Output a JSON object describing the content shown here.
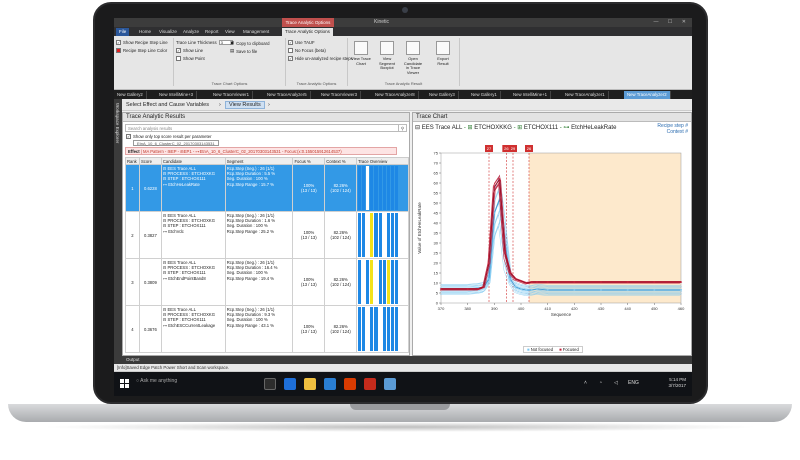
{
  "window": {
    "title": "Kinetic",
    "context_tab": "Trace Analytic Options",
    "controls": "— ☐ ✕"
  },
  "ribbon_tabs": [
    "File",
    "Home",
    "Visualize",
    "Analyze",
    "Report",
    "View",
    "Management",
    "Trace Analytic Options"
  ],
  "ribbon": {
    "show_step_line": "Show Recipe Step Line",
    "step_line_color": "Recipe Step Line Color",
    "step_line_color_hex": "#e02020",
    "show_line": "Show Line",
    "show_point": "Show Point",
    "line_thickness_label": "Trace Line Thickness",
    "line_thickness_value": "3",
    "copy_clipboard": "Copy to clipboard",
    "save_file": "Save to file",
    "group_chart_options": "Trace Chart Options",
    "use_tmuf": "Use TAUF",
    "no_focus": "No Focus (beta)",
    "hide_analyzed": "Hide un-analyzed recipe steps",
    "btn_view_trace": "View Trace Chart",
    "btn_view_segment": "View Segment Boxplot",
    "btn_open_candidate": "Open Candidate in Trace Viewer",
    "btn_export": "Export Result",
    "group_analytic_options": "Trace Analytic Options",
    "group_analytic_result": "Trace Analytic Result"
  },
  "doc_tabs": [
    "New Gallery2",
    "New IntelliMine+3",
    "New TraceViewer1",
    "New TraceAnalyzer5",
    "New TraceViewer3",
    "New TraceAnalyzer8",
    "New Gallery3",
    "New Gallery1",
    "New IntelliMine+1",
    "New TraceAnalyzer1",
    "New TraceAnalyzer2"
  ],
  "explorer_label": "Workspace Explorer",
  "breadcrumbs": {
    "step1": "Select Effect and Cause Variables",
    "step2": "View Results"
  },
  "results_panel": {
    "title": "Trace Analytic Results",
    "search_placeholder": "Search analysis results",
    "show_top_only": "Show only top score result per parameter",
    "chip": "EtnA_10_6_ClusterC_02_20170303143531",
    "effect_label": "Effect",
    "effect_text": " | MA Pattern - ⊞EP - ⊞EP1 - ⊶EtnA_10_6_ClusterC_02_20170303143531 - Focus:(x:0.155015912614537)",
    "columns": [
      "Rank",
      "Score",
      "Candidate",
      "Segment",
      "Focus %",
      "Context %",
      "Trace Overview"
    ],
    "rows": [
      {
        "rank": "1",
        "score": "0.6228",
        "tree": [
          "⊟ EES Trace ALL",
          "  ⊟ PROCESS : ETCHOXKG",
          "    ⊟ STEP : ETCHOX111",
          "      ⊶ EtchHeLeakRate"
        ],
        "segment": [
          "Rcp.Step (Seg.) : 26 (1/1)",
          "Rcp.Step Duration : 5.5 %",
          "Seg. Duration : 100 %",
          "Rcp.Step Range : 15.7 %"
        ],
        "focus": "100%\n(13 / 13)",
        "context": "82.26%\n(102 / 124)"
      },
      {
        "rank": "2",
        "score": "0.3827",
        "tree": [
          "⊟ EES Trace ALL",
          "  ⊟ PROCESS : ETCHOXKG",
          "    ⊟ STEP : ETCHOX111",
          "      ⊶ EtchVdc"
        ],
        "segment": [
          "Rcp.Step (Seg.) : 26 (1/1)",
          "Rcp.Step Duration : 1.6 %",
          "Seg. Duration : 100 %",
          "Rcp.Step Range : 25.2 %"
        ],
        "focus": "100%\n(13 / 13)",
        "context": "82.26%\n(102 / 124)"
      },
      {
        "rank": "3",
        "score": "0.3809",
        "tree": [
          "⊟ EES Trace ALL",
          "  ⊟ PROCESS : ETCHOXKG",
          "    ⊟ STEP : ETCHOX111",
          "      ⊶ EtchEndPointBand8"
        ],
        "segment": [
          "Rcp.Step (Seg.) : 26 (1/1)",
          "Rcp.Step Duration : 16.4 %",
          "Seg. Duration : 100 %",
          "Rcp.Step Range : 19.4 %"
        ],
        "focus": "100%\n(13 / 13)",
        "context": "82.26%\n(102 / 124)"
      },
      {
        "rank": "4",
        "score": "0.3676",
        "tree": [
          "⊟ EES Trace ALL",
          "  ⊟ PROCESS : ETCHOXKG",
          "    ⊟ STEP : ETCHOX111",
          "      ⊶ EtchESCCurrentLeakage"
        ],
        "segment": [
          "Rcp.Step (Seg.) : 26 (1/1)",
          "Rcp.Step Duration : 9.3 %",
          "Seg. Duration : 100 %",
          "Rcp.Step Range : 43.1 %"
        ],
        "focus": "100%\n(13 / 13)",
        "context": "82.26%\n(102 / 124)"
      }
    ]
  },
  "chart_panel": {
    "title": "Trace Chart",
    "header_trace": "EES Trace ALL",
    "header_process": "ETCHOXKKG",
    "header_step": "ETCHOX111",
    "header_param": "EtchHeLeakRate",
    "recipe_step": "Recipe step #",
    "context_label": "Context #",
    "legend_not_focused": "Not focused",
    "legend_focused": "Focused"
  },
  "chart_data": {
    "type": "line",
    "xlabel": "Sequence",
    "ylabel": "Value of EtchHeLeakRate",
    "xlim": [
      370,
      460
    ],
    "ylim": [
      0,
      75
    ],
    "xticks": [
      370,
      380,
      390,
      400,
      410,
      420,
      430,
      440,
      450,
      460
    ],
    "yticks": [
      0,
      5,
      10,
      15,
      20,
      25,
      30,
      35,
      40,
      45,
      50,
      55,
      60,
      65,
      70,
      75
    ],
    "step_markers": [
      {
        "label": "27",
        "x": 388
      },
      {
        "label": "26",
        "x": 394.5
      },
      {
        "label": "29",
        "x": 397
      },
      {
        "label": "26",
        "x": 403
      }
    ],
    "highlight_region": [
      403,
      460
    ],
    "series": [
      {
        "name": "Not focused",
        "color": "#7ec8f0",
        "x": [
          370,
          380,
          384,
          386,
          388,
          390,
          392,
          394,
          396,
          398,
          400,
          402,
          404,
          406,
          410,
          420,
          430,
          440,
          450,
          460
        ],
        "y": [
          7,
          7,
          7.5,
          8,
          12,
          45,
          52,
          30,
          12,
          8,
          7,
          6.5,
          6.5,
          7,
          6.5,
          6.5,
          6.5,
          6.5,
          6.5,
          6.5
        ]
      },
      {
        "name": "Focused",
        "color": "#c0203a",
        "x": [
          370,
          380,
          384,
          386,
          388,
          390,
          392,
          394,
          396,
          398,
          400,
          402,
          404,
          406,
          410,
          420,
          430,
          440,
          450,
          460
        ],
        "y": [
          7,
          7,
          7,
          8,
          20,
          58,
          62,
          25,
          15,
          12,
          11,
          10,
          10.5,
          10.5,
          10.5,
          10.5,
          10.5,
          10.5,
          10.5,
          10.5
        ]
      }
    ]
  },
  "output_label": "Output",
  "status_text": "[Info]Saved Edge Patch Power Short and Scan workspace.",
  "taskbar": {
    "search_text": "Ask me anything",
    "time": "5:14 PM",
    "date": "3/7/2017",
    "lang": "ENG"
  }
}
